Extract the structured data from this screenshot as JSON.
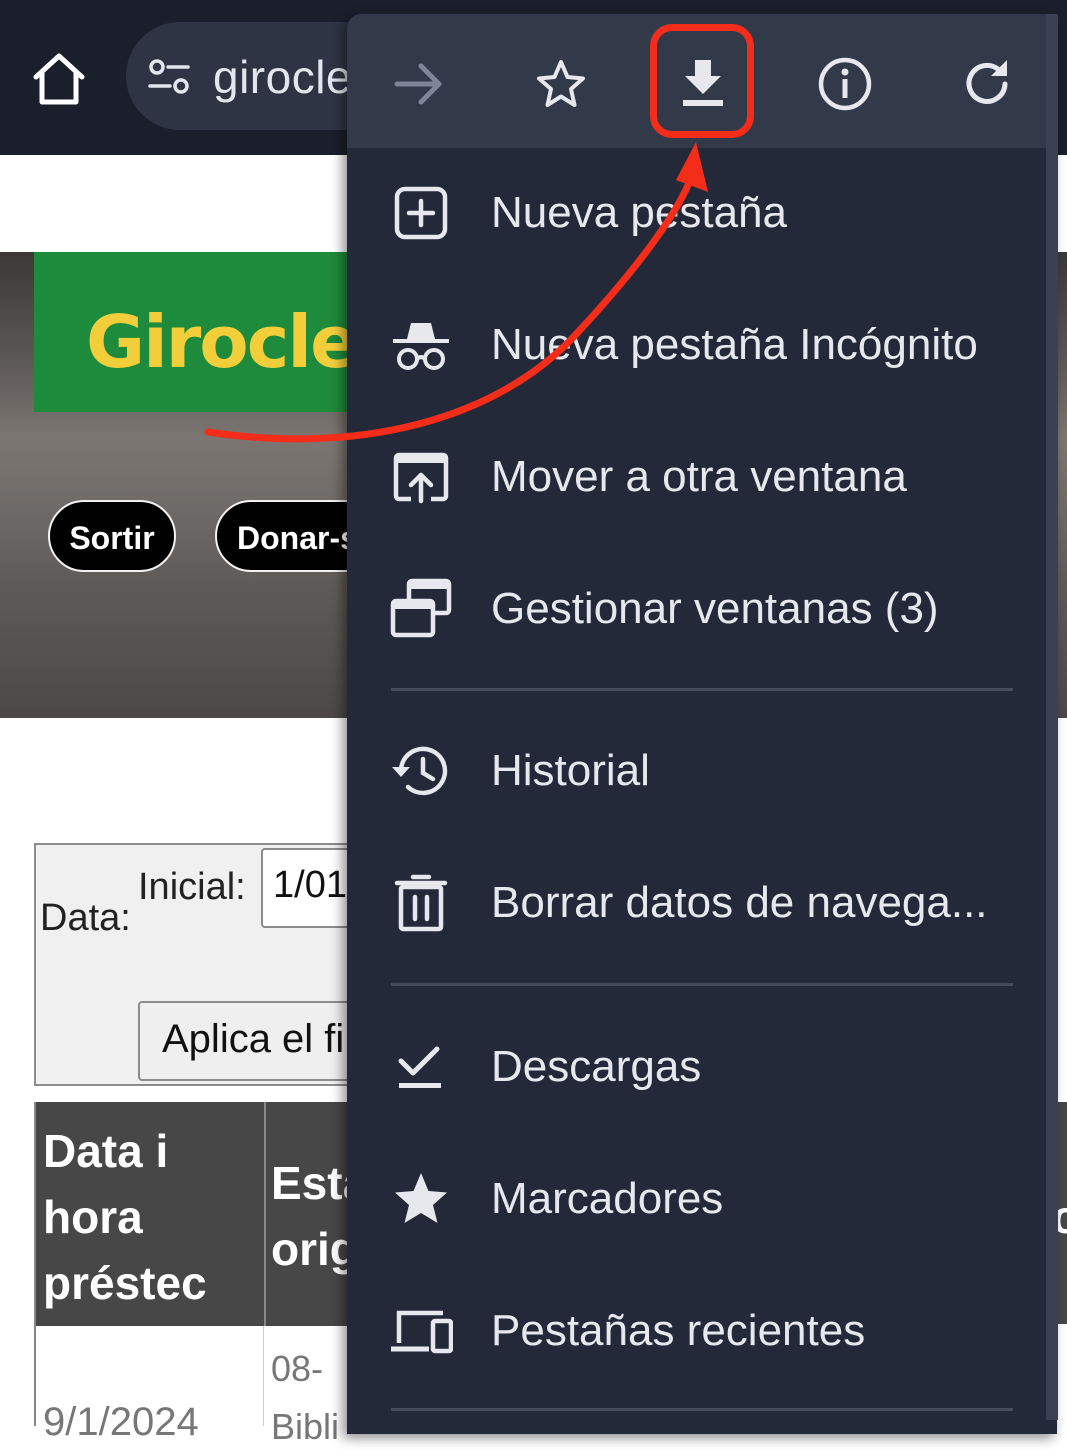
{
  "browser": {
    "url_text": "girocle",
    "toolbar_icons": [
      "home-icon",
      "tune-icon"
    ]
  },
  "page": {
    "logo_text": "Girocle",
    "buttons": {
      "sortir": "Sortir",
      "donar": "Donar-s"
    },
    "filter": {
      "data_label": "Data:",
      "inicial_label": "Inicial:",
      "inicial_value": "1/01",
      "apply_label": "Aplica el fi"
    },
    "table": {
      "headers": [
        "Data i hora préstec",
        "Esta orig"
      ],
      "row1": {
        "date": "9/1/2024",
        "station": "08- Bibli"
      },
      "right_header_fragment": "c"
    }
  },
  "menu": {
    "toolbar": [
      {
        "name": "forward",
        "icon": "arrow-forward-icon",
        "enabled": false
      },
      {
        "name": "bookmark",
        "icon": "star-outline-icon",
        "enabled": true
      },
      {
        "name": "download",
        "icon": "download-icon",
        "enabled": true,
        "highlighted": true
      },
      {
        "name": "page-info",
        "icon": "info-icon",
        "enabled": true
      },
      {
        "name": "reload",
        "icon": "reload-icon",
        "enabled": true
      }
    ],
    "items": [
      {
        "label": "Nueva pestaña",
        "icon": "new-tab-icon"
      },
      {
        "label": "Nueva pestaña Incógnito",
        "icon": "incognito-icon"
      },
      {
        "label": "Mover a otra ventana",
        "icon": "move-window-icon"
      },
      {
        "label": "Gestionar ventanas (3)",
        "icon": "manage-windows-icon"
      },
      {
        "label": "Historial",
        "icon": "history-icon"
      },
      {
        "label": "Borrar datos de navega...",
        "icon": "trash-icon"
      },
      {
        "label": "Descargas",
        "icon": "downloads-check-icon"
      },
      {
        "label": "Marcadores",
        "icon": "star-filled-icon"
      },
      {
        "label": "Pestañas recientes",
        "icon": "devices-icon"
      }
    ]
  },
  "colors": {
    "menu_bg": "#232939",
    "menu_toolbar_bg": "#323a4a",
    "topbar_bg": "#1b1f2b",
    "highlight_red": "#f42d1b",
    "logo_green": "#1e8a3b",
    "logo_yellow": "#f2cf3a"
  }
}
